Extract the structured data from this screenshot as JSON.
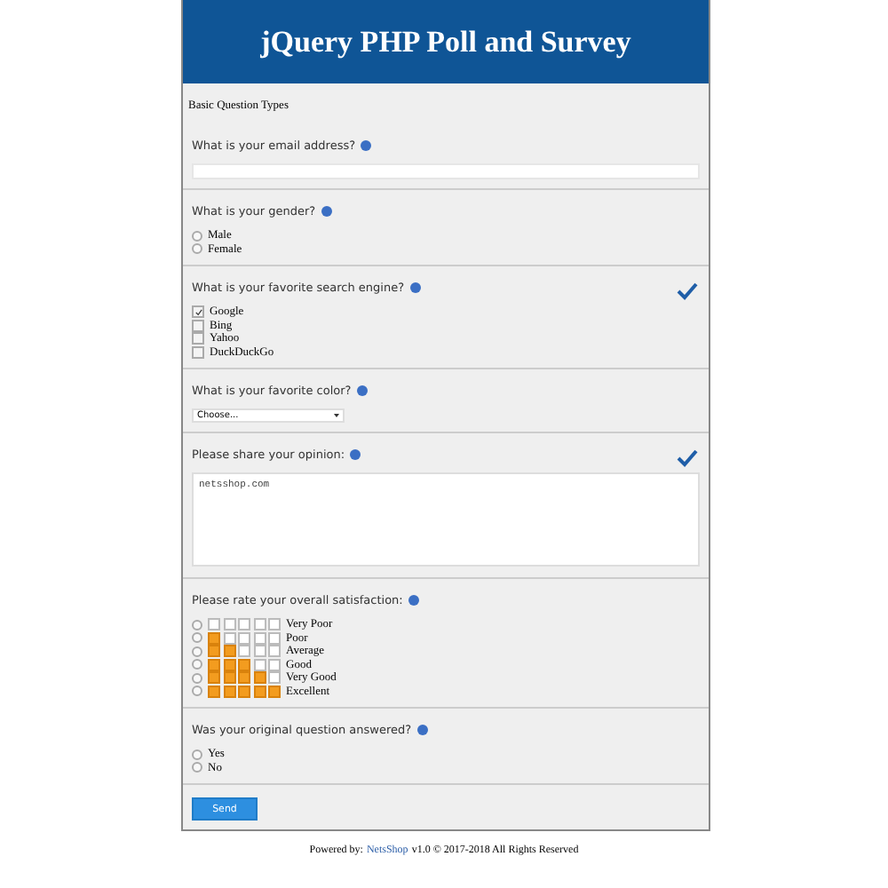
{
  "header": {
    "title": "jQuery PHP Poll and Survey"
  },
  "section_title": "Basic Question Types",
  "questions": [
    {
      "kind": "text",
      "label": "What is your email address?",
      "answered": false
    },
    {
      "kind": "radio",
      "label": "What is your gender?",
      "answered": false,
      "options": [
        {
          "label": "Male",
          "selected": false
        },
        {
          "label": "Female",
          "selected": false
        }
      ]
    },
    {
      "kind": "checkbox",
      "label": "What is your favorite search engine?",
      "answered": true,
      "options": [
        {
          "label": "Google",
          "checked": true
        },
        {
          "label": "Bing",
          "checked": false
        },
        {
          "label": "Yahoo",
          "checked": false
        },
        {
          "label": "DuckDuckGo",
          "checked": false
        }
      ]
    },
    {
      "kind": "select",
      "label": "What is your favorite color?",
      "answered": false,
      "value": "Choose..."
    },
    {
      "kind": "textarea",
      "label": "Please share your opinion:",
      "answered": true,
      "value": "netsshop.com"
    },
    {
      "kind": "rating",
      "label": "Please rate your overall satisfaction:",
      "answered": false,
      "options": [
        {
          "label": "Very Poor",
          "stars": 0,
          "selected": false
        },
        {
          "label": "Poor",
          "stars": 1,
          "selected": false
        },
        {
          "label": "Average",
          "stars": 2,
          "selected": false
        },
        {
          "label": "Good",
          "stars": 3,
          "selected": false
        },
        {
          "label": "Very Good",
          "stars": 4,
          "selected": false
        },
        {
          "label": "Excellent",
          "stars": 5,
          "selected": false
        }
      ]
    },
    {
      "kind": "radio",
      "label": "Was your original question answered?",
      "answered": false,
      "options": [
        {
          "label": "Yes",
          "selected": false
        },
        {
          "label": "No",
          "selected": false
        }
      ]
    }
  ],
  "submit": "Send",
  "footer": {
    "prefix": "Powered by:",
    "link": "NetsShop",
    "suffix": "v1.0 © 2017-2018 All Rights Reserved"
  }
}
